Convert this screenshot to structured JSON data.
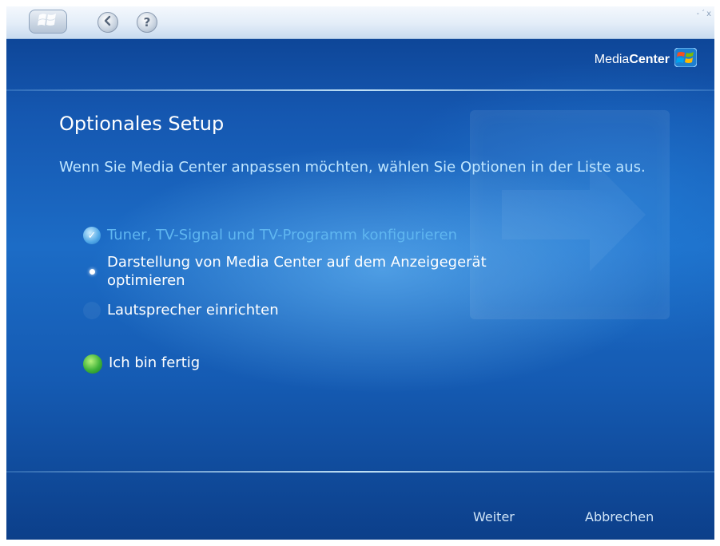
{
  "window": {
    "brand_prefix": "Media",
    "brand_suffix": "Center",
    "controls": [
      "-",
      "´",
      "x"
    ]
  },
  "main": {
    "title": "Optionales Setup",
    "intro": "Wenn Sie Media Center anpassen möchten, wählen Sie Optionen in der Liste aus.",
    "options": [
      {
        "label": "Tuner, TV-Signal und TV-Programm konfigurieren",
        "state": "completed"
      },
      {
        "label": "Darstellung von Media Center auf dem Anzeigegerät optimieren",
        "state": "focused"
      },
      {
        "label": "Lautsprecher einrichten",
        "state": "pending"
      },
      {
        "label": "Ich bin fertig",
        "state": "finish"
      }
    ]
  },
  "footer": {
    "next_label": "Weiter",
    "cancel_label": "Abbrechen"
  },
  "colors": {
    "completed_option_text": "#5fb6f0",
    "intro_text": "#bfe6ff",
    "finish_icon": "#3fb33a"
  }
}
